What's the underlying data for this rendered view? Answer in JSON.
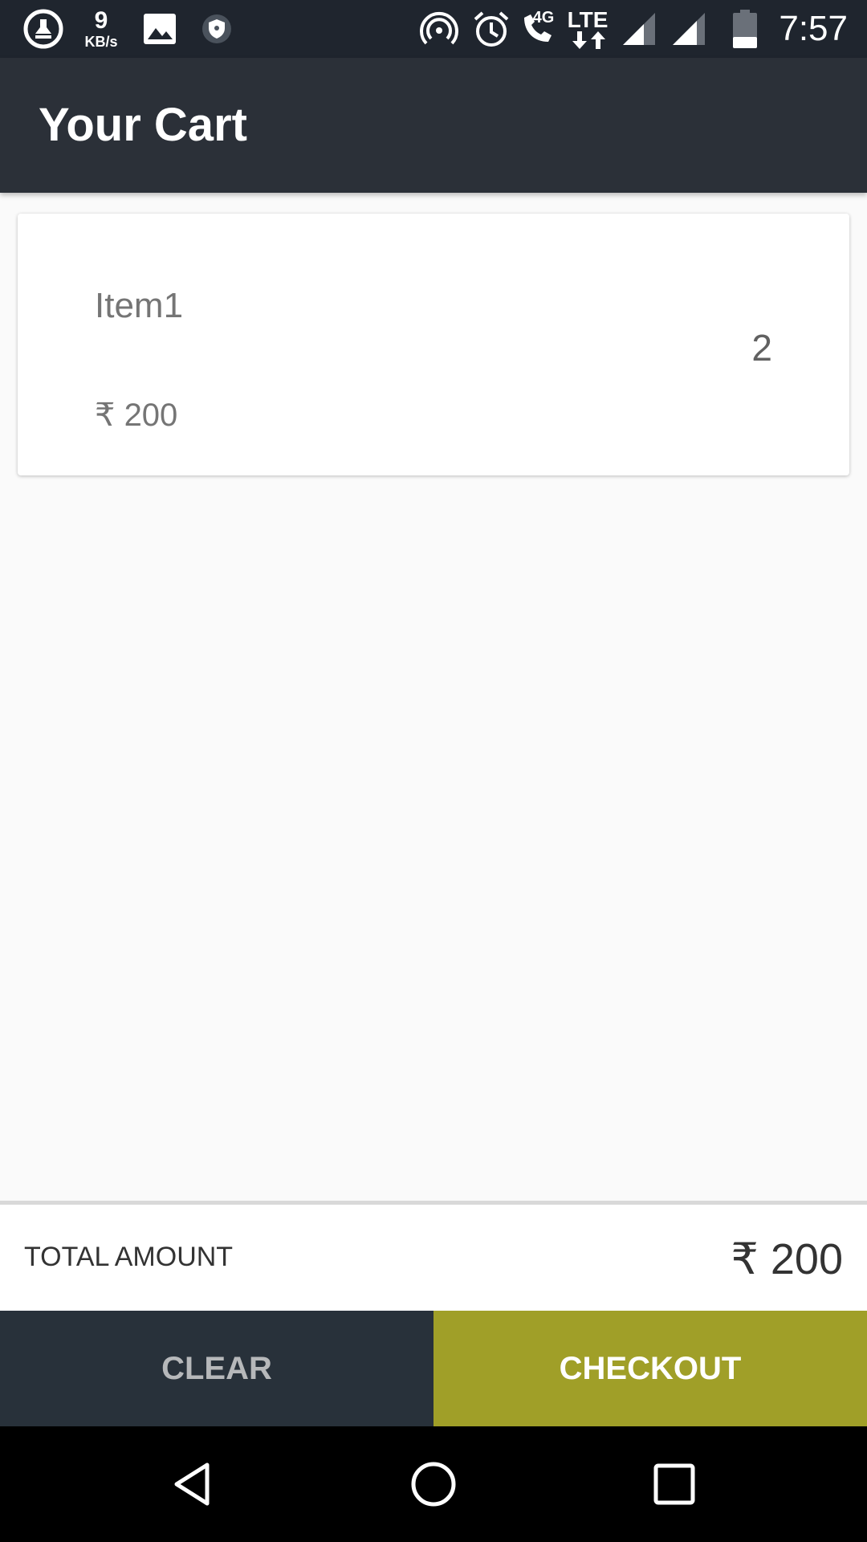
{
  "status_bar": {
    "net_speed_value": "9",
    "net_speed_unit": "KB/s",
    "network_label": "4G",
    "lte_label": "LTE",
    "time": "7:57",
    "icons": [
      "cleaner-icon",
      "image-icon",
      "shield-icon",
      "hotspot-icon",
      "alarm-icon",
      "wifi-call-icon",
      "signal-icon",
      "signal-icon",
      "battery-icon"
    ]
  },
  "app_bar": {
    "title": "Your Cart"
  },
  "cart": {
    "items": [
      {
        "name": "Item1",
        "price": "₹ 200",
        "quantity": "2"
      }
    ]
  },
  "total": {
    "label": "TOTAL AMOUNT",
    "value": "₹ 200"
  },
  "actions": {
    "clear_label": "CLEAR",
    "checkout_label": "CHECKOUT"
  },
  "colors": {
    "status_bar_bg": "#1f252e",
    "app_bar_bg": "#2b3038",
    "clear_bg": "#28313a",
    "checkout_bg": "#a09f28"
  },
  "nav_bar": {
    "icons": [
      "back-icon",
      "home-icon",
      "recents-icon"
    ]
  }
}
